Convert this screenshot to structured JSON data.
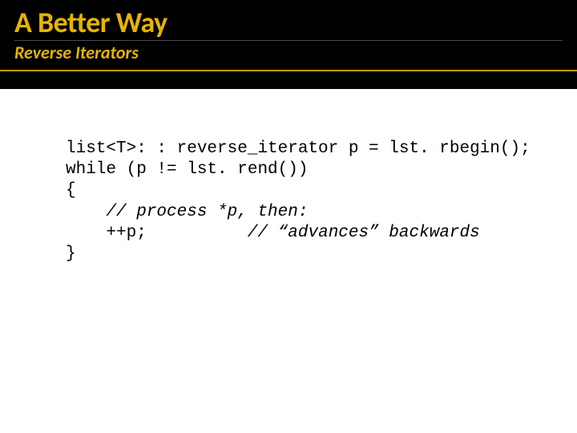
{
  "header": {
    "title": "A Better Way",
    "subtitle": "Reverse Iterators"
  },
  "code": {
    "line1": "list<T>: : reverse_iterator p = lst. rbegin();",
    "line2": "while (p != lst. rend())",
    "line3": "{",
    "line4_indent": "    ",
    "line4_comment": "// process *p, then:",
    "line5_indent": "    ",
    "line5_stmt": "++p;",
    "line5_gap": "          ",
    "line5_comment": "// “advances” backwards",
    "line6": "}"
  }
}
